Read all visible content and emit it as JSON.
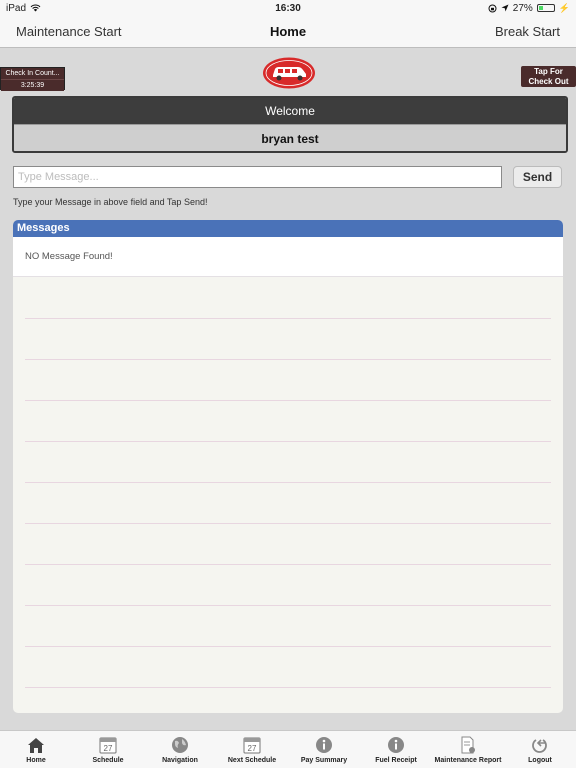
{
  "status": {
    "device": "iPad",
    "time": "16:30",
    "battery_percent": "27%",
    "battery_level": 0.27
  },
  "nav": {
    "left": "Maintenance Start",
    "title": "Home",
    "right": "Break Start"
  },
  "checkin": {
    "label": "Check In Count...",
    "timer": "3:25:39"
  },
  "checkout": {
    "line1": "Tap For",
    "line2": "Check Out"
  },
  "welcome": {
    "heading": "Welcome",
    "name": "bryan test"
  },
  "composer": {
    "placeholder": "Type Message...",
    "send_label": "Send",
    "hint": "Type your Message in above field and Tap Send!"
  },
  "messages": {
    "heading": "Messages",
    "empty_text": "NO Message Found!"
  },
  "colors": {
    "accent_blue": "#4a72b8",
    "dark_header": "#3d3d3d",
    "badge_brown": "#4a2b2b",
    "logo_red": "#d82a2a"
  },
  "tabs": [
    {
      "label": "Home",
      "icon": "home-icon"
    },
    {
      "label": "Schedule",
      "icon": "calendar-icon"
    },
    {
      "label": "Navigation",
      "icon": "globe-icon"
    },
    {
      "label": "Next Schedule",
      "icon": "calendar-icon"
    },
    {
      "label": "Pay Summary",
      "icon": "info-icon"
    },
    {
      "label": "Fuel Receipt",
      "icon": "info-icon"
    },
    {
      "label": "Maintenance Report",
      "icon": "report-icon"
    },
    {
      "label": "Logout",
      "icon": "logout-icon"
    }
  ],
  "calendar_day": "27"
}
